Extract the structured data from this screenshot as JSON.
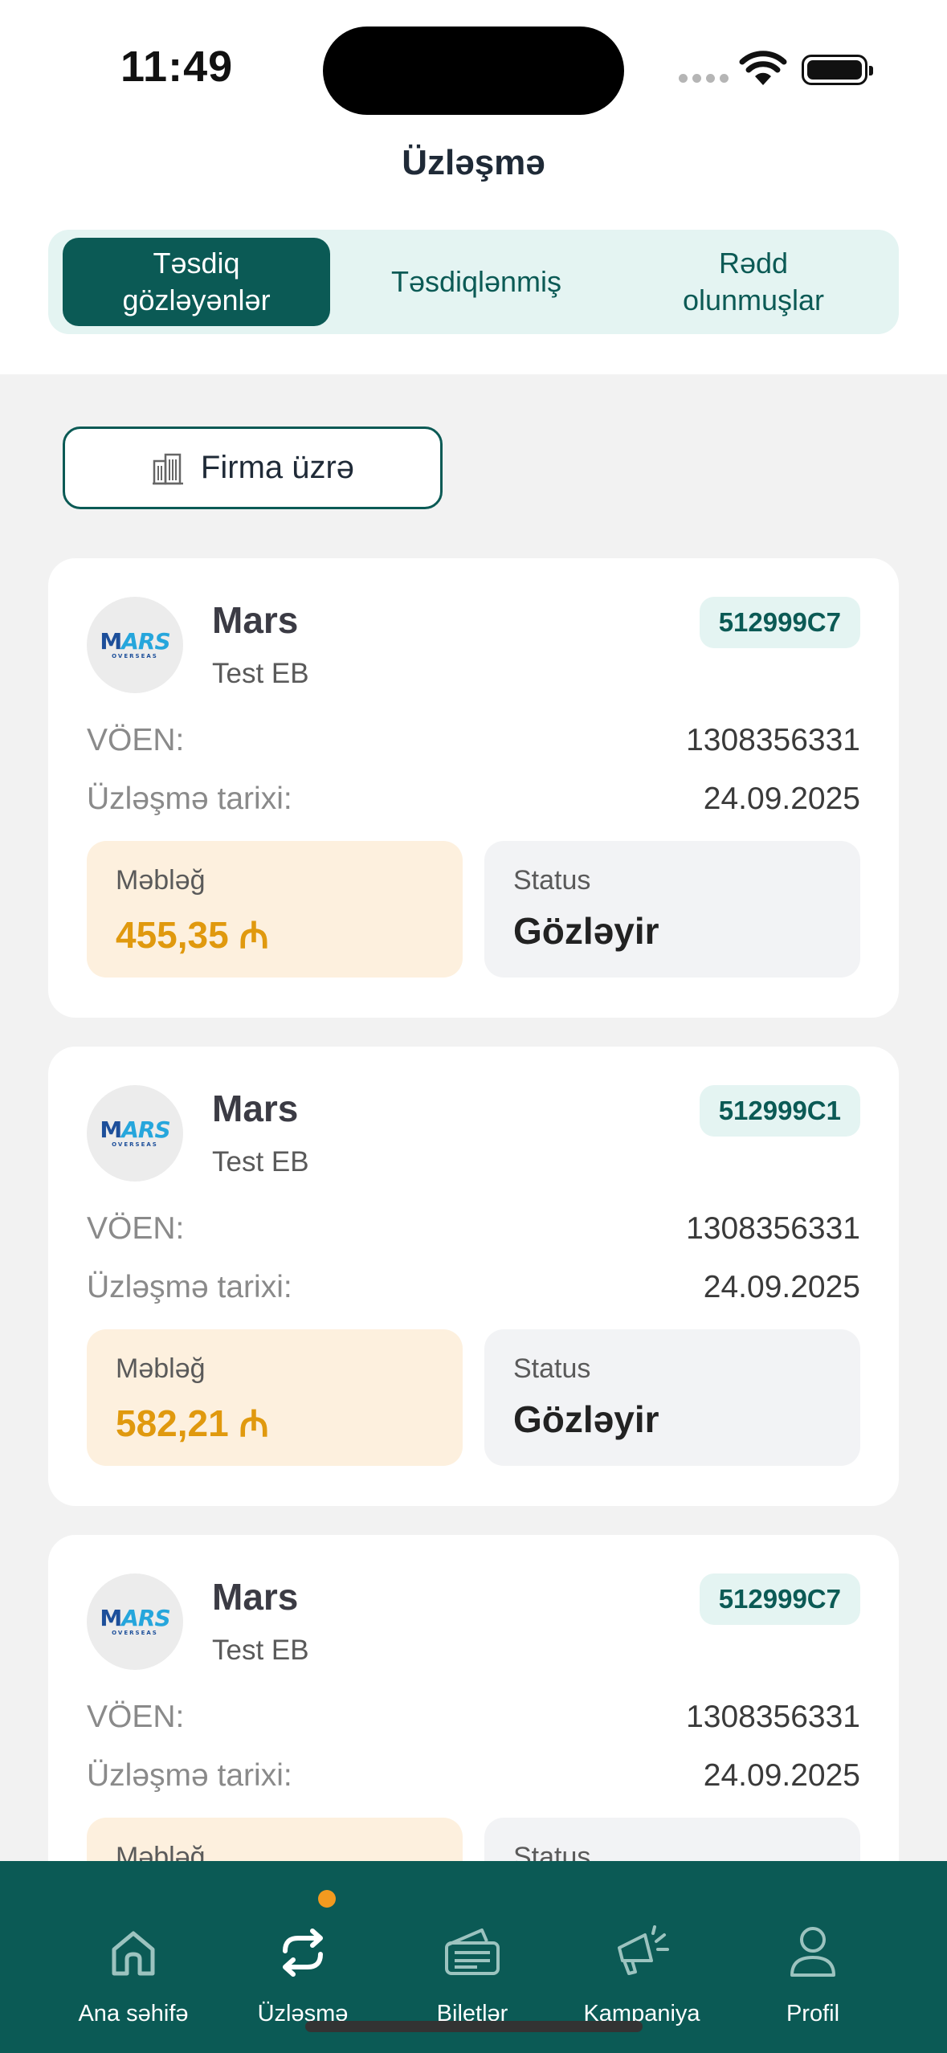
{
  "status_bar": {
    "time": "11:49"
  },
  "header": {
    "title": "Üzləşmə"
  },
  "tabs": [
    {
      "label": "Təsdiq gözləyənlər",
      "active": true
    },
    {
      "label": "Təsdiqlənmiş",
      "active": false
    },
    {
      "label": "Rədd olunmuşlar",
      "active": false
    }
  ],
  "filter": {
    "label": "Firma üzrə",
    "icon": "building-icon"
  },
  "labels": {
    "voen": "VÖEN:",
    "date": "Üzləşmə tarixi:",
    "amount": "Məbləğ",
    "status": "Status"
  },
  "cards": [
    {
      "logo_text": "MARS",
      "logo_sub": "OVERSEAS",
      "name": "Mars",
      "subtitle": "Test EB",
      "code": "512999C7",
      "voen": "1308356331",
      "date": "24.09.2025",
      "amount": "455,35 ₼",
      "status": "Gözləyir"
    },
    {
      "logo_text": "MARS",
      "logo_sub": "OVERSEAS",
      "name": "Mars",
      "subtitle": "Test EB",
      "code": "512999C1",
      "voen": "1308356331",
      "date": "24.09.2025",
      "amount": "582,21 ₼",
      "status": "Gözləyir"
    },
    {
      "logo_text": "MARS",
      "logo_sub": "OVERSEAS",
      "name": "Mars",
      "subtitle": "Test EB",
      "code": "512999C7",
      "voen": "1308356331",
      "date": "24.09.2025",
      "amount": "",
      "status": ""
    }
  ],
  "nav": [
    {
      "label": "Ana səhifə",
      "icon": "home-icon"
    },
    {
      "label": "Üzləşmə",
      "icon": "sync-icon",
      "badge": true
    },
    {
      "label": "Biletlər",
      "icon": "ticket-icon"
    },
    {
      "label": "Kampaniya",
      "icon": "megaphone-icon"
    },
    {
      "label": "Profil",
      "icon": "user-icon"
    }
  ],
  "colors": {
    "primary": "#0b5a55",
    "accent": "#e0990e",
    "badge": "#f29a1f"
  }
}
